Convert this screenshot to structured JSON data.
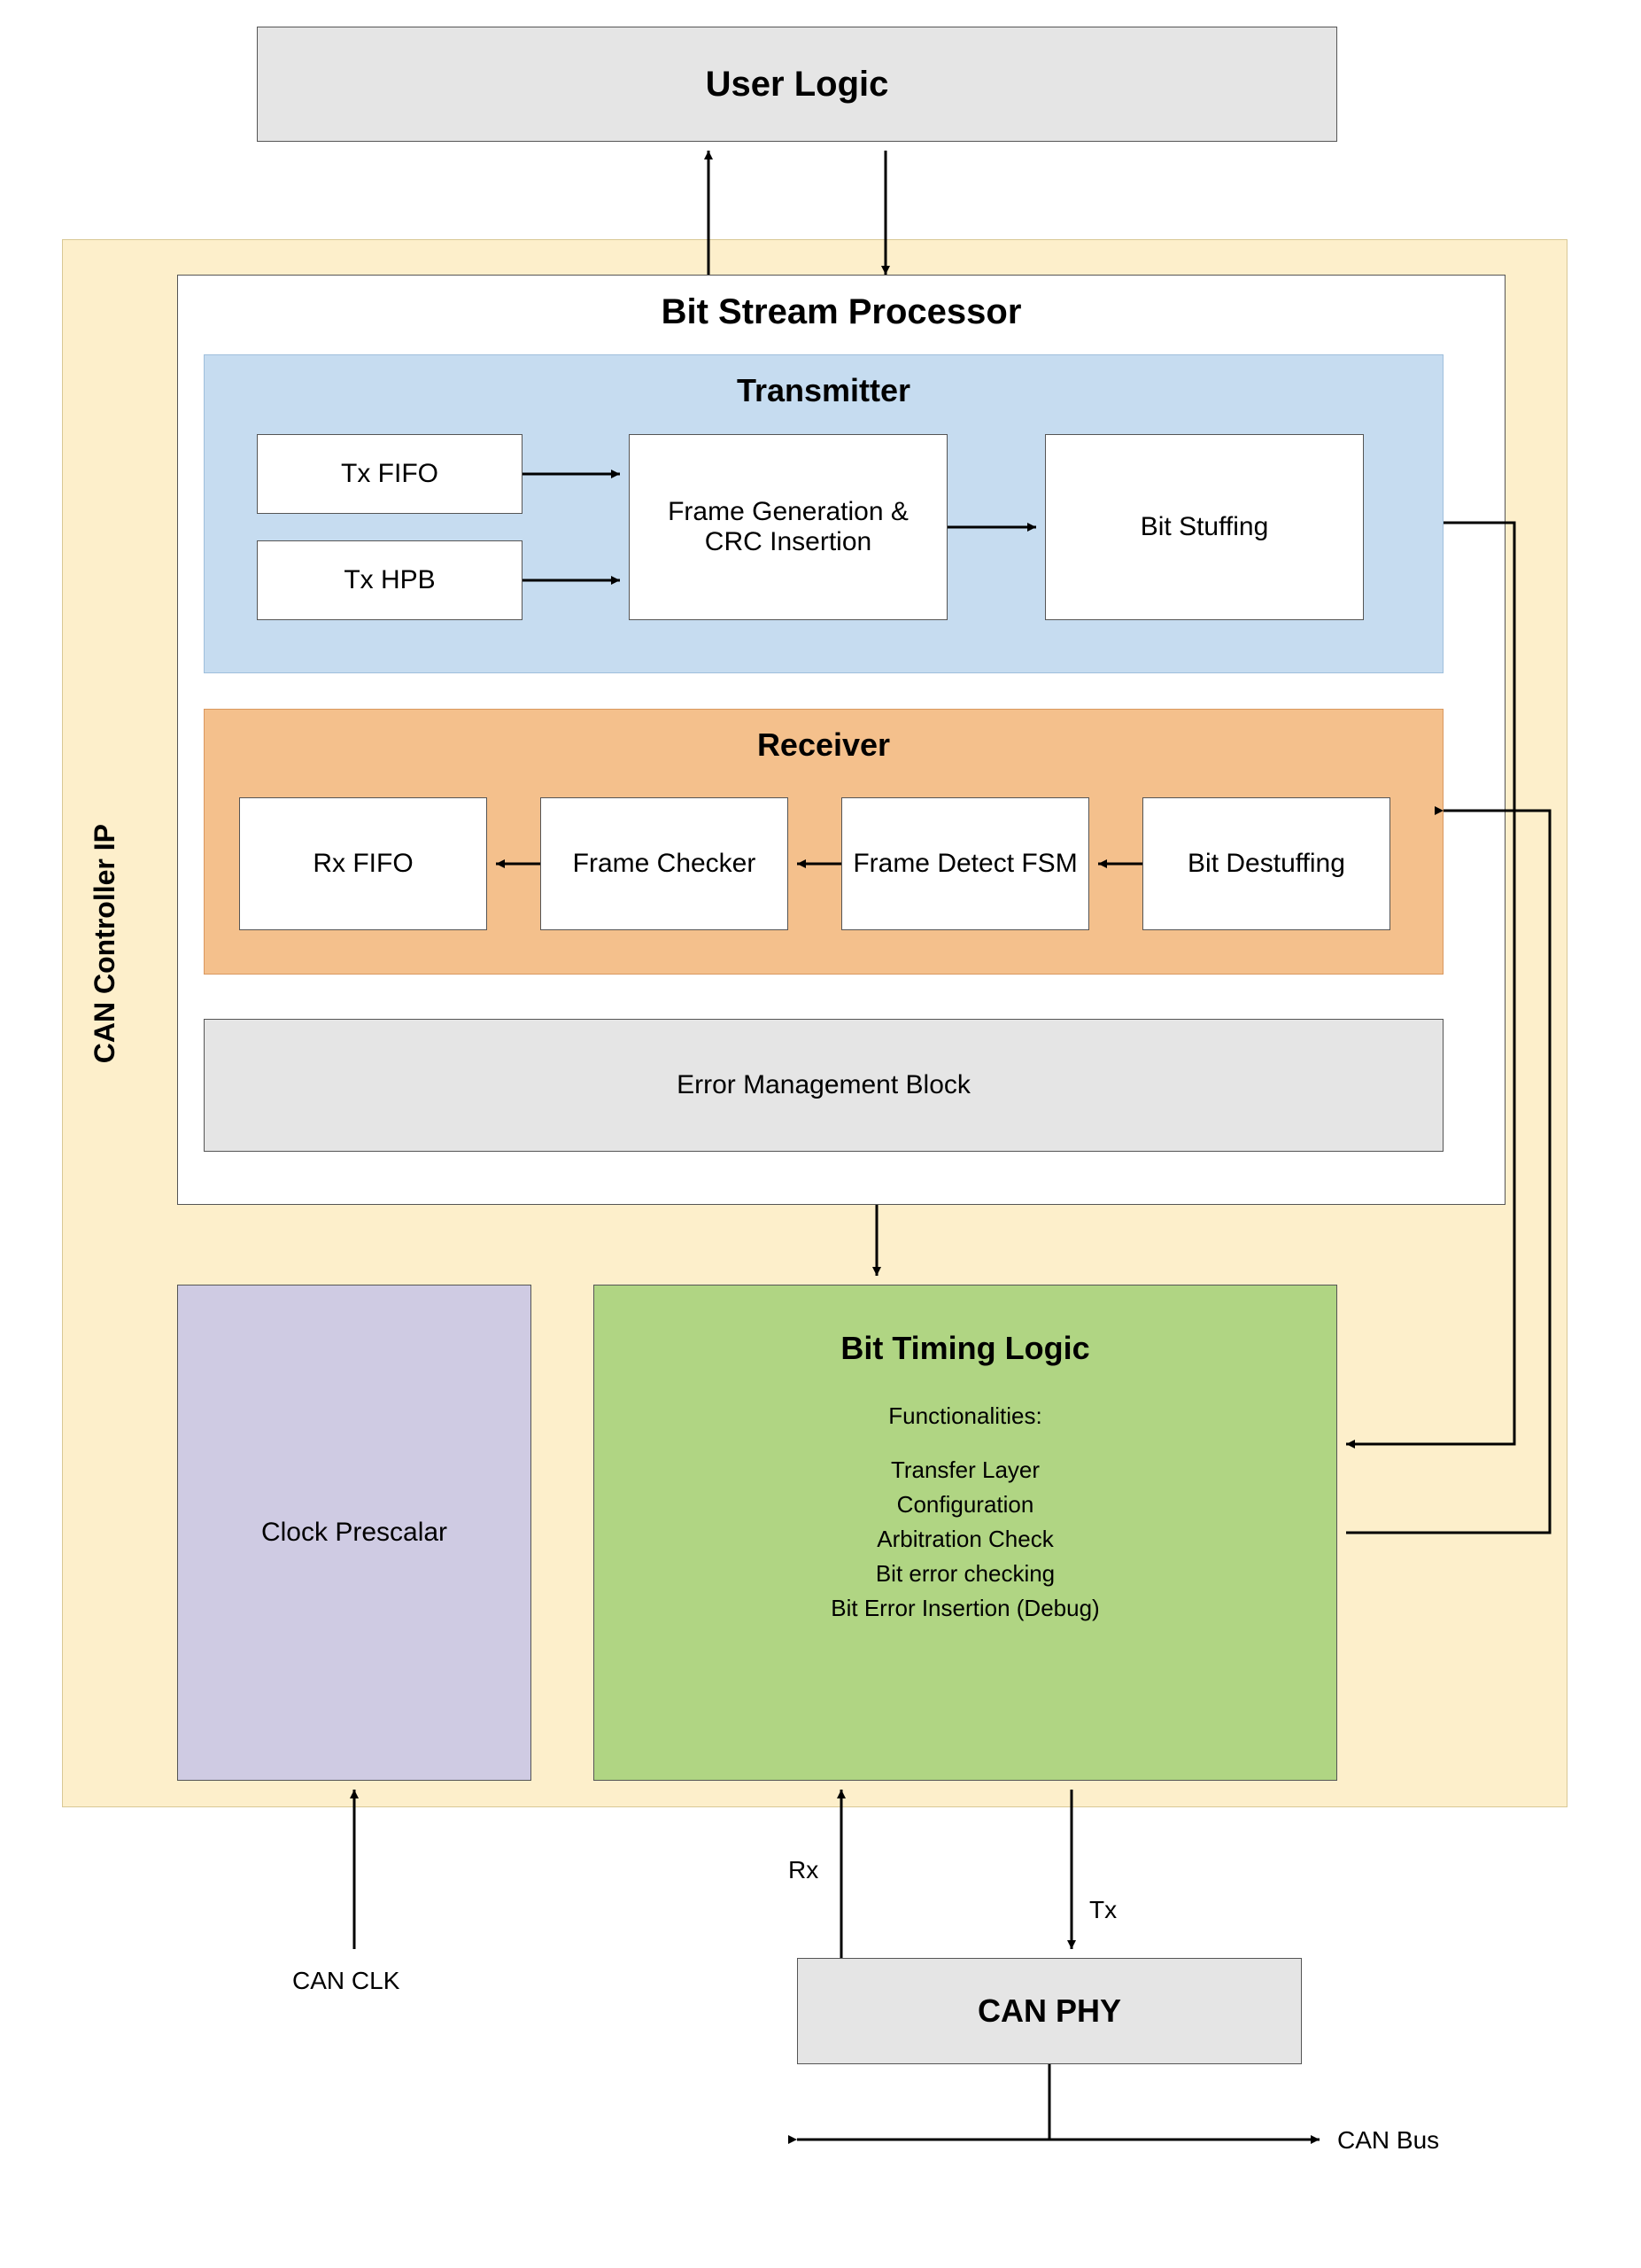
{
  "user_logic": "User Logic",
  "controller_label": "CAN Controller IP",
  "bsp": {
    "title": "Bit Stream Processor",
    "tx": {
      "title": "Transmitter",
      "tx_fifo": "Tx FIFO",
      "tx_hpb": "Tx HPB",
      "frame_gen": "Frame Generation & CRC Insertion",
      "bit_stuff": "Bit Stuffing"
    },
    "rx": {
      "title": "Receiver",
      "rx_fifo": "Rx FIFO",
      "frame_checker": "Frame Checker",
      "frame_detect": "Frame Detect FSM",
      "bit_destuff": "Bit Destuffing"
    },
    "error_mgmt": "Error Management Block"
  },
  "clock_prescalar": "Clock Prescalar",
  "btl": {
    "title": "Bit Timing Logic",
    "sub": "Functionalities:",
    "items": [
      "Transfer Layer",
      "Configuration",
      "Arbitration Check",
      "Bit error checking",
      "Bit Error Insertion (Debug)"
    ]
  },
  "can_clk": "CAN CLK",
  "rx_label": "Rx",
  "tx_label": "Tx",
  "can_phy": "CAN PHY",
  "can_bus": "CAN Bus"
}
